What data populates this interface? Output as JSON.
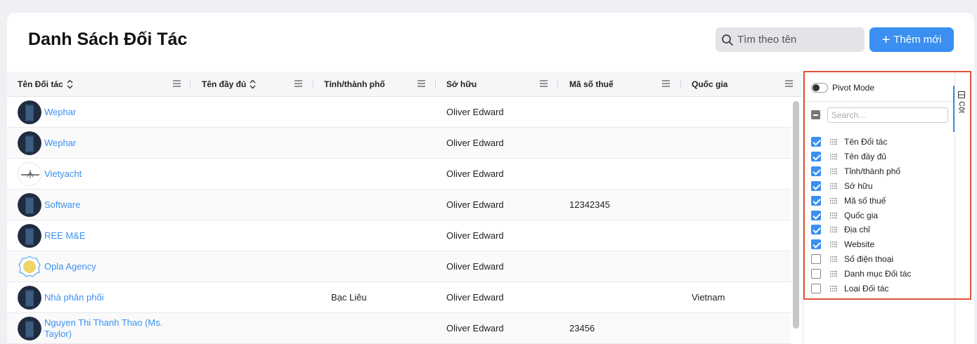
{
  "page": {
    "title": "Danh Sách Đối Tác"
  },
  "toolbar": {
    "search_placeholder": "Tìm theo tên",
    "add_label": "Thêm mới",
    "add_icon": "plus-icon"
  },
  "grid": {
    "columns": [
      "Tên Đối tác",
      "Tên đầy đủ",
      "Tỉnh/thành phố",
      "Sở hữu",
      "Mã số thuế",
      "Quốc gia"
    ],
    "rows": [
      {
        "name": "Wephar",
        "avatar": "building",
        "full_name": "",
        "city": "",
        "owner": "Oliver Edward",
        "tax": "",
        "country": ""
      },
      {
        "name": "Wephar",
        "avatar": "building",
        "full_name": "",
        "city": "",
        "owner": "Oliver Edward",
        "tax": "",
        "country": ""
      },
      {
        "name": "Vietyacht",
        "avatar": "vietyacht-logo",
        "full_name": "",
        "city": "",
        "owner": "Oliver Edward",
        "tax": "",
        "country": ""
      },
      {
        "name": "Software",
        "avatar": "building",
        "full_name": "",
        "city": "",
        "owner": "Oliver Edward",
        "tax": "12342345",
        "country": ""
      },
      {
        "name": "REE M&E",
        "avatar": "building",
        "full_name": "",
        "city": "",
        "owner": "Oliver Edward",
        "tax": "",
        "country": ""
      },
      {
        "name": "Opla Agency",
        "avatar": "opla-logo",
        "full_name": "",
        "city": "",
        "owner": "Oliver Edward",
        "tax": "",
        "country": ""
      },
      {
        "name": "Nhà phân phối",
        "avatar": "building",
        "full_name": "",
        "city": "Bạc Liêu",
        "owner": "Oliver Edward",
        "tax": "",
        "country": "Vietnam"
      },
      {
        "name": "Nguyen Thi Thanh Thao (Ms. Taylor)",
        "avatar": "building",
        "full_name": "",
        "city": "",
        "owner": "Oliver Edward",
        "tax": "23456",
        "country": ""
      }
    ]
  },
  "tool_panel": {
    "pivot_label": "Pivot Mode",
    "pivot_on": false,
    "search_placeholder": "Search...",
    "tab_label": "Cột",
    "columns": [
      {
        "label": "Tên Đối tác",
        "checked": true
      },
      {
        "label": "Tên đầy đủ",
        "checked": true
      },
      {
        "label": "Tỉnh/thành phố",
        "checked": true
      },
      {
        "label": "Sở hữu",
        "checked": true
      },
      {
        "label": "Mã số thuế",
        "checked": true
      },
      {
        "label": "Quốc gia",
        "checked": true
      },
      {
        "label": "Địa chỉ",
        "checked": true
      },
      {
        "label": "Website",
        "checked": true
      },
      {
        "label": "Số điện thoại",
        "checked": false
      },
      {
        "label": "Danh mục Đối tác",
        "checked": false
      },
      {
        "label": "Loại Đối tác",
        "checked": false
      }
    ]
  },
  "colors": {
    "accent": "#3a8ff0",
    "highlight": "#e0533a"
  }
}
